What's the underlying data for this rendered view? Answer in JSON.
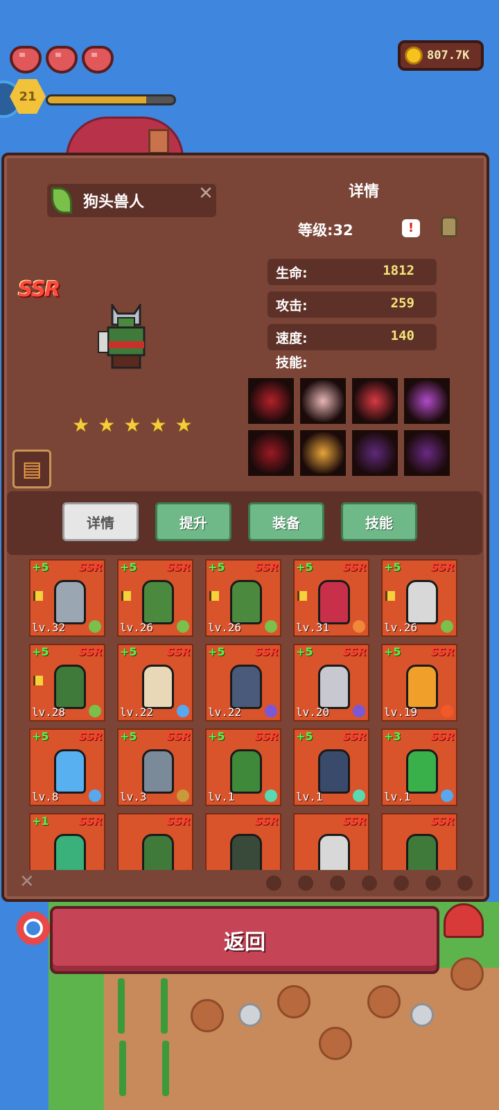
{
  "hud": {
    "coins": "807.7K",
    "player_level": "21",
    "xp_fraction": 0.78,
    "hearts": 3
  },
  "hero": {
    "name": "狗头兽人",
    "rarity": "SSR",
    "stars": [
      "★",
      "★",
      "★",
      "★",
      "★"
    ],
    "detail_title": "详情",
    "level_text": "等级:32",
    "stats": [
      {
        "label": "生命:",
        "value": "1812"
      },
      {
        "label": "攻击:",
        "value": "259"
      },
      {
        "label": "速度:",
        "value": "140"
      }
    ],
    "skills_label": "技能:",
    "skills": [
      {
        "icon": "claw-slash-icon",
        "color": "#b3212a"
      },
      {
        "icon": "blood-fountain-icon",
        "color": "#e7b6b6"
      },
      {
        "icon": "red-sword-icon",
        "color": "#d83a44"
      },
      {
        "icon": "purple-spiral-icon",
        "color": "#b04cc8"
      },
      {
        "icon": "demon-face-icon",
        "color": "#9a1a24"
      },
      {
        "icon": "shadow-figures-icon",
        "color": "#e8a43a"
      },
      {
        "icon": "fanged-maw-icon",
        "color": "#5e2a7a"
      },
      {
        "icon": "dark-hood-icon",
        "color": "#6a2a84"
      }
    ]
  },
  "tabs": [
    {
      "label": "详情",
      "active": true
    },
    {
      "label": "提升",
      "active": false
    },
    {
      "label": "装备",
      "active": false
    },
    {
      "label": "技能",
      "active": false
    }
  ],
  "cards": [
    {
      "plus": "+5",
      "rarity": "SSR",
      "level": "lv.32",
      "flag": true,
      "element": "#7ac04a",
      "fig": "#9aa7b3"
    },
    {
      "plus": "+5",
      "rarity": "SSR",
      "level": "lv.26",
      "flag": true,
      "element": "#7ac04a",
      "fig": "#4b8a3e"
    },
    {
      "plus": "+5",
      "rarity": "SSR",
      "level": "lv.26",
      "flag": true,
      "element": "#7ac04a",
      "fig": "#4b8a3e"
    },
    {
      "plus": "+5",
      "rarity": "SSR",
      "level": "lv.31",
      "flag": true,
      "element": "#f0883a",
      "fig": "#c8304a"
    },
    {
      "plus": "+5",
      "rarity": "SSR",
      "level": "lv.26",
      "flag": true,
      "element": "#7ac04a",
      "fig": "#d8d8d8"
    },
    {
      "plus": "+5",
      "rarity": "SSR",
      "level": "lv.28",
      "flag": true,
      "element": "#7ac04a",
      "fig": "#3f7a3a"
    },
    {
      "plus": "+5",
      "rarity": "SSR",
      "level": "lv.22",
      "flag": false,
      "element": "#58a8f0",
      "fig": "#e8d8b8"
    },
    {
      "plus": "+5",
      "rarity": "SSR",
      "level": "lv.22",
      "flag": false,
      "element": "#7a58d8",
      "fig": "#4a5a7a"
    },
    {
      "plus": "+5",
      "rarity": "SSR",
      "level": "lv.20",
      "flag": false,
      "element": "#7a58d8",
      "fig": "#c8c8d0"
    },
    {
      "plus": "+5",
      "rarity": "SSR",
      "level": "lv.19",
      "flag": false,
      "element": "#f05a2a",
      "fig": "#f0a02a"
    },
    {
      "plus": "+5",
      "rarity": "SSR",
      "level": "lv.8",
      "flag": false,
      "element": "#58a8f0",
      "fig": "#58b0f0"
    },
    {
      "plus": "+5",
      "rarity": "SSR",
      "level": "lv.3",
      "flag": false,
      "element": "#c89a3a",
      "fig": "#7a8a98"
    },
    {
      "plus": "+5",
      "rarity": "SSR",
      "level": "lv.1",
      "flag": false,
      "element": "#5ad8b0",
      "fig": "#3f8a3a"
    },
    {
      "plus": "+5",
      "rarity": "SSR",
      "level": "lv.1",
      "flag": false,
      "element": "#5ad8b0",
      "fig": "#3a4a6a"
    },
    {
      "plus": "+3",
      "rarity": "SSR",
      "level": "lv.1",
      "flag": false,
      "element": "#58a8f0",
      "fig": "#3ab04a"
    },
    {
      "plus": "+1",
      "rarity": "SSR",
      "level": "",
      "flag": false,
      "element": "",
      "fig": "#3ab07a"
    },
    {
      "plus": "",
      "rarity": "SSR",
      "level": "",
      "flag": false,
      "element": "",
      "fig": "#3f7a3a"
    },
    {
      "plus": "",
      "rarity": "SSR",
      "level": "",
      "flag": false,
      "element": "",
      "fig": "#3a4a3a"
    },
    {
      "plus": "",
      "rarity": "SSR",
      "level": "",
      "flag": false,
      "element": "",
      "fig": "#d8d8d8"
    },
    {
      "plus": "",
      "rarity": "SSR",
      "level": "",
      "flag": false,
      "element": "",
      "fig": "#3f7a3a"
    }
  ],
  "filters": [
    "fire-icon",
    "leaf-icon",
    "water-drop-icon",
    "earth-icon",
    "flame-icon",
    "gear-icon",
    "moon-icon"
  ],
  "back_label": "返回"
}
